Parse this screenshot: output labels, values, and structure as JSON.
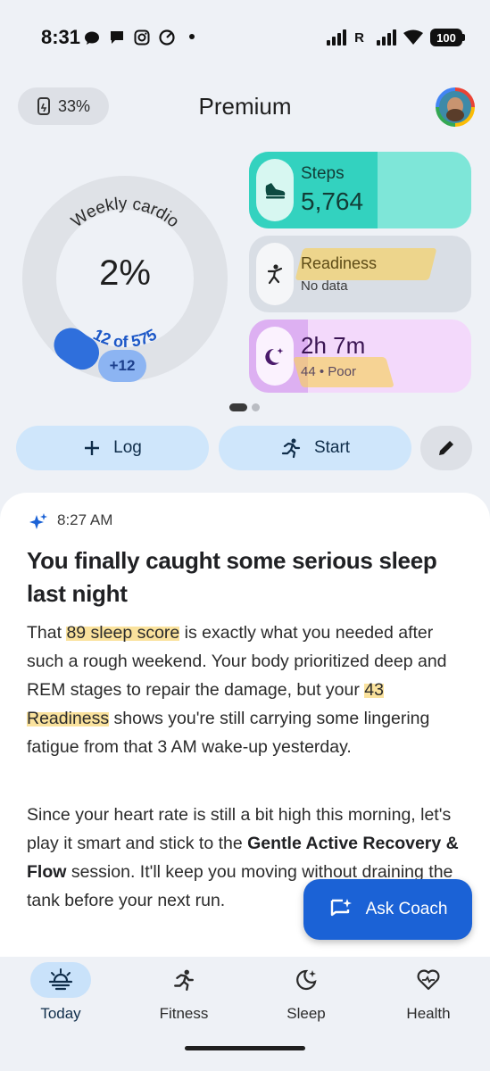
{
  "status_bar": {
    "time": "8:31",
    "signal_label": "R",
    "battery": "100"
  },
  "header": {
    "watch_battery": "33%",
    "title": "Premium"
  },
  "cardio": {
    "label": "Weekly cardio",
    "value": "2%",
    "progress_text": "12 of 575",
    "progress_fraction": 0.021,
    "increment": "+12"
  },
  "tiles": {
    "steps": {
      "label": "Steps",
      "value": "5,764"
    },
    "readiness": {
      "label": "Readiness",
      "value": "No data"
    },
    "sleep": {
      "value": "2h 7m",
      "detail": "44 • Poor"
    }
  },
  "actions": {
    "log_label": "Log",
    "start_label": "Start"
  },
  "insight": {
    "time": "8:27 AM",
    "title": "You finally caught some serious sleep last night",
    "p1_pre": "That ",
    "p1_hl1": "89 sleep score",
    "p1_mid": " is exactly what you needed after such a rough weekend. Your body prioritized deep and REM stages to repair the damage, but your ",
    "p1_hl2": "43 Readiness",
    "p1_post": " shows you're still carrying some lingering fatigue from that 3 AM wake-up yesterday.",
    "p2_pre": "Since your heart rate is still a bit high this morning, let's play it smart and stick to the ",
    "p2_bold": "Gentle Active Recovery & Flow",
    "p2_post": " session. It'll keep you moving without draining the tank before your next run."
  },
  "ask_coach": {
    "label": "Ask Coach"
  },
  "nav": [
    {
      "label": "Today",
      "icon": "sunrise-icon"
    },
    {
      "label": "Fitness",
      "icon": "running-icon"
    },
    {
      "label": "Sleep",
      "icon": "moon-icon"
    },
    {
      "label": "Health",
      "icon": "heart-icon"
    }
  ],
  "colors": {
    "accent": "#1b62d6",
    "steps": "#33d2bf",
    "sleep": "#ddb0f2",
    "highlight": "#f7cf5c"
  }
}
